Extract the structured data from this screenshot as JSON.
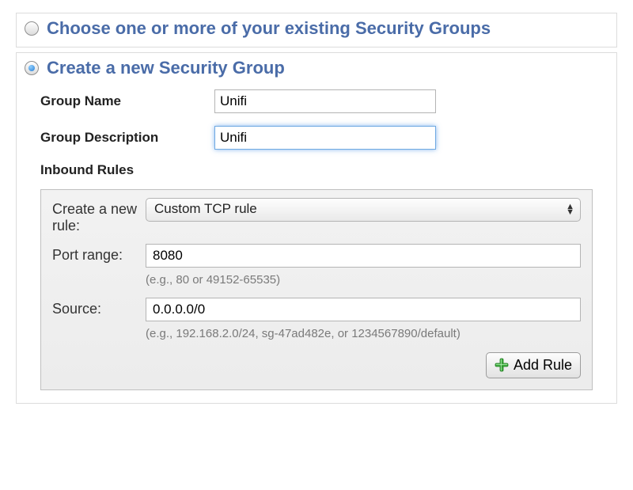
{
  "sections": {
    "choose_existing": {
      "title": "Choose one or more of your existing Security Groups",
      "selected": false
    },
    "create_new": {
      "title": "Create a new Security Group",
      "selected": true
    }
  },
  "form": {
    "group_name_label": "Group Name",
    "group_name_value": "Unifi",
    "group_description_label": "Group Description",
    "group_description_value": "Unifi",
    "inbound_rules_label": "Inbound Rules"
  },
  "rule_panel": {
    "new_rule_label": "Create a new rule:",
    "rule_type_selected": "Custom TCP rule",
    "port_range_label": "Port range:",
    "port_range_value": "8080",
    "port_range_hint": "(e.g., 80 or 49152-65535)",
    "source_label": "Source:",
    "source_value": "0.0.0.0/0",
    "source_hint": "(e.g., 192.168.2.0/24, sg-47ad482e, or 1234567890/default)",
    "add_rule_label": "Add Rule"
  }
}
